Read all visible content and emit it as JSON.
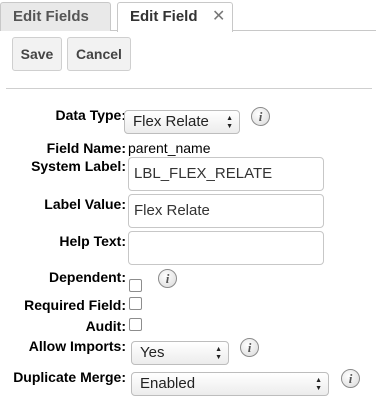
{
  "tabs": [
    {
      "label": "Edit Fields"
    },
    {
      "label": "Edit Field",
      "close_glyph": "✕"
    }
  ],
  "toolbar": {
    "save_label": "Save",
    "cancel_label": "Cancel"
  },
  "form": {
    "data_type": {
      "label": "Data Type:",
      "value": "Flex Relate"
    },
    "field_name": {
      "label": "Field Name:",
      "value": "parent_name"
    },
    "system_label": {
      "label": "System Label:",
      "value": "LBL_FLEX_RELATE"
    },
    "label_value": {
      "label": "Label Value:",
      "value": "Flex Relate"
    },
    "help_text": {
      "label": "Help Text:",
      "value": ""
    },
    "dependent": {
      "label": "Dependent:",
      "checked": false
    },
    "required_field": {
      "label": "Required Field:",
      "checked": false
    },
    "audit": {
      "label": "Audit:",
      "checked": false
    },
    "allow_imports": {
      "label": "Allow Imports:",
      "value": "Yes"
    },
    "duplicate_merge": {
      "label": "Duplicate Merge:",
      "value": "Enabled"
    }
  },
  "icons": {
    "info_glyph": "i",
    "select_arrow": "▲▼"
  }
}
